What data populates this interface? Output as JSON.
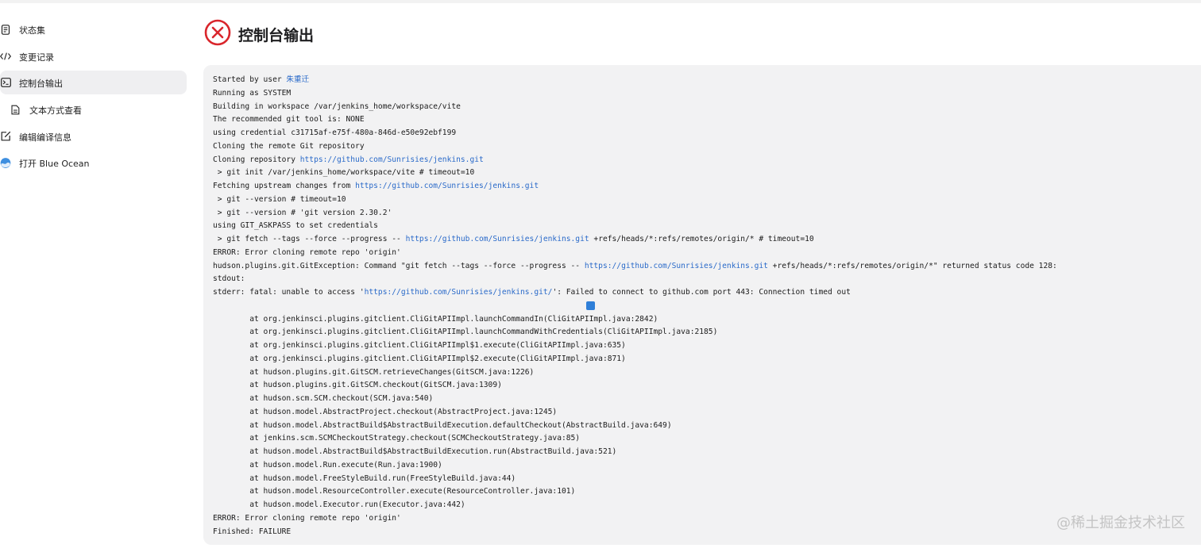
{
  "sidebar": {
    "items": [
      {
        "label": "状态集",
        "icon": "document-icon"
      },
      {
        "label": "变更记录",
        "icon": "code-icon"
      },
      {
        "label": "控制台输出",
        "icon": "terminal-icon",
        "active": true
      },
      {
        "label": "文本方式查看",
        "icon": "file-icon",
        "sub": true
      },
      {
        "label": "编辑编译信息",
        "icon": "edit-icon"
      },
      {
        "label": "打开 Blue Ocean",
        "icon": "blue-ocean-icon"
      }
    ]
  },
  "header": {
    "title": "控制台输出",
    "status_icon": "error-circle-icon",
    "status_color": "#d9262c"
  },
  "console": {
    "lines": [
      {
        "parts": [
          {
            "t": "Started by user "
          },
          {
            "t": "朱重迁",
            "link": true
          }
        ]
      },
      {
        "parts": [
          {
            "t": "Running as SYSTEM"
          }
        ]
      },
      {
        "parts": [
          {
            "t": "Building in workspace /var/jenkins_home/workspace/vite"
          }
        ]
      },
      {
        "parts": [
          {
            "t": "The recommended git tool is: NONE"
          }
        ]
      },
      {
        "parts": [
          {
            "t": "using credential c31715af-e75f-480a-846d-e50e92ebf199"
          }
        ]
      },
      {
        "parts": [
          {
            "t": "Cloning the remote Git repository"
          }
        ]
      },
      {
        "parts": [
          {
            "t": "Cloning repository "
          },
          {
            "t": "https://github.com/Sunrisies/jenkins.git",
            "link": true
          }
        ]
      },
      {
        "parts": [
          {
            "t": " > git init /var/jenkins_home/workspace/vite # timeout=10"
          }
        ]
      },
      {
        "parts": [
          {
            "t": "Fetching upstream changes from "
          },
          {
            "t": "https://github.com/Sunrisies/jenkins.git",
            "link": true
          }
        ]
      },
      {
        "parts": [
          {
            "t": " > git --version # timeout=10"
          }
        ]
      },
      {
        "parts": [
          {
            "t": " > git --version # 'git version 2.30.2'"
          }
        ]
      },
      {
        "parts": [
          {
            "t": "using GIT_ASKPASS to set credentials"
          }
        ]
      },
      {
        "parts": [
          {
            "t": " > git fetch --tags --force --progress -- "
          },
          {
            "t": "https://github.com/Sunrisies/jenkins.git",
            "link": true
          },
          {
            "t": " +refs/heads/*:refs/remotes/origin/* # timeout=10"
          }
        ]
      },
      {
        "parts": [
          {
            "t": "ERROR: Error cloning remote repo 'origin'"
          }
        ]
      },
      {
        "parts": [
          {
            "t": "hudson.plugins.git.GitException: Command \"git fetch --tags --force --progress -- "
          },
          {
            "t": "https://github.com/Sunrisies/jenkins.git",
            "link": true
          },
          {
            "t": " +refs/heads/*:refs/remotes/origin/*\" returned status code 128:"
          }
        ]
      },
      {
        "parts": [
          {
            "t": "stdout:"
          }
        ]
      },
      {
        "parts": [
          {
            "t": "stderr: fatal: unable to access '"
          },
          {
            "t": "https://github.com/Sunrisies/jenkins.git/",
            "link": true
          },
          {
            "t": "': Failed to connect to github.com port 443: Connection timed out"
          }
        ]
      },
      {
        "parts": [
          {
            "t": ""
          }
        ],
        "blank": true
      },
      {
        "parts": [
          {
            "t": "        at org.jenkinsci.plugins.gitclient.CliGitAPIImpl.launchCommandIn(CliGitAPIImpl.java:2842)"
          }
        ]
      },
      {
        "parts": [
          {
            "t": "        at org.jenkinsci.plugins.gitclient.CliGitAPIImpl.launchCommandWithCredentials(CliGitAPIImpl.java:2185)"
          }
        ]
      },
      {
        "parts": [
          {
            "t": "        at org.jenkinsci.plugins.gitclient.CliGitAPIImpl$1.execute(CliGitAPIImpl.java:635)"
          }
        ]
      },
      {
        "parts": [
          {
            "t": "        at org.jenkinsci.plugins.gitclient.CliGitAPIImpl$2.execute(CliGitAPIImpl.java:871)"
          }
        ]
      },
      {
        "parts": [
          {
            "t": "        at hudson.plugins.git.GitSCM.retrieveChanges(GitSCM.java:1226)"
          }
        ]
      },
      {
        "parts": [
          {
            "t": "        at hudson.plugins.git.GitSCM.checkout(GitSCM.java:1309)"
          }
        ]
      },
      {
        "parts": [
          {
            "t": "        at hudson.scm.SCM.checkout(SCM.java:540)"
          }
        ]
      },
      {
        "parts": [
          {
            "t": "        at hudson.model.AbstractProject.checkout(AbstractProject.java:1245)"
          }
        ]
      },
      {
        "parts": [
          {
            "t": "        at hudson.model.AbstractBuild$AbstractBuildExecution.defaultCheckout(AbstractBuild.java:649)"
          }
        ]
      },
      {
        "parts": [
          {
            "t": "        at jenkins.scm.SCMCheckoutStrategy.checkout(SCMCheckoutStrategy.java:85)"
          }
        ]
      },
      {
        "parts": [
          {
            "t": "        at hudson.model.AbstractBuild$AbstractBuildExecution.run(AbstractBuild.java:521)"
          }
        ]
      },
      {
        "parts": [
          {
            "t": "        at hudson.model.Run.execute(Run.java:1900)"
          }
        ]
      },
      {
        "parts": [
          {
            "t": "        at hudson.model.FreeStyleBuild.run(FreeStyleBuild.java:44)"
          }
        ]
      },
      {
        "parts": [
          {
            "t": "        at hudson.model.ResourceController.execute(ResourceController.java:101)"
          }
        ]
      },
      {
        "parts": [
          {
            "t": "        at hudson.model.Executor.run(Executor.java:442)"
          }
        ]
      },
      {
        "parts": [
          {
            "t": "ERROR: Error cloning remote repo 'origin'"
          }
        ]
      },
      {
        "parts": [
          {
            "t": "Finished: FAILURE"
          }
        ]
      }
    ]
  },
  "watermark": "@稀土掘金技术社区",
  "colors": {
    "link": "#2a6ac9",
    "console_bg": "#f2f2f3",
    "active_bg": "#efeff1"
  }
}
